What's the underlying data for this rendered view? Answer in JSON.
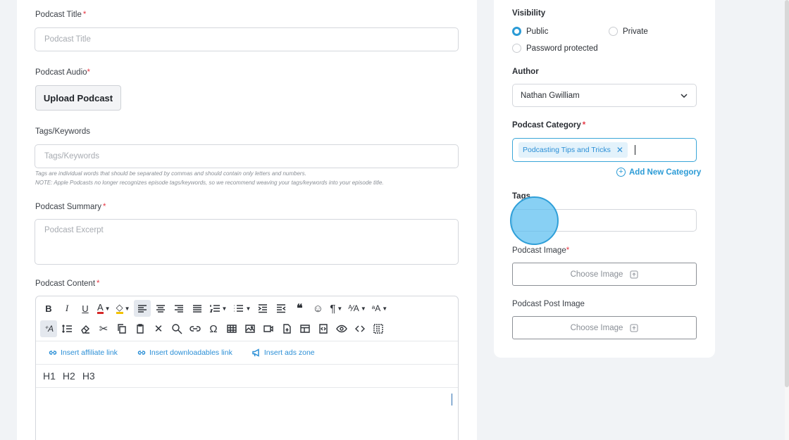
{
  "main": {
    "title_label": "Podcast Title",
    "title_placeholder": "Podcast Title",
    "audio_label": "Podcast Audio",
    "upload_button": "Upload Podcast",
    "tags_label": "Tags/Keywords",
    "tags_placeholder": "Tags/Keywords",
    "tags_hint_1": "Tags are individual words that should be separated by commas and should contain only letters and numbers.",
    "tags_hint_2": "NOTE: Apple Podcasts no longer recognizes episode tags/keywords, so we recommend weaving your tags/keywords into your episode title.",
    "summary_label": "Podcast Summary",
    "summary_placeholder": "Podcast Excerpt",
    "content_label": "Podcast Content",
    "required_mark": "*"
  },
  "editor": {
    "insert_links": [
      "Insert affiliate link",
      "Insert downloadables link",
      "Insert ads zone"
    ],
    "headings": [
      "H1",
      "H2",
      "H3"
    ]
  },
  "side": {
    "visibility_label": "Visibility",
    "visibility_options": [
      "Public",
      "Private",
      "Password protected"
    ],
    "visibility_selected": "Public",
    "author_label": "Author",
    "author_value": "Nathan Gwilliam",
    "category_label": "Podcast Category",
    "category_chip": "Podcasting Tips and Tricks",
    "add_category": "Add New Category",
    "tags_label": "Tags",
    "image_label": "Podcast Image",
    "choose_image": "Choose Image",
    "post_image_label": "Podcast Post Image"
  },
  "colors": {
    "accent": "#2b9bd6",
    "required": "#e63946"
  }
}
